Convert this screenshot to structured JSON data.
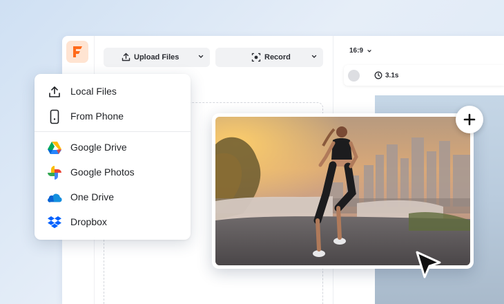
{
  "toolbar": {
    "upload_label": "Upload Files",
    "record_label": "Record"
  },
  "preview": {
    "aspect_ratio": "16:9",
    "duration": "3.1s"
  },
  "upload_menu": {
    "items": [
      {
        "label": "Local Files",
        "icon": "upload-icon"
      },
      {
        "label": "From Phone",
        "icon": "phone-icon"
      },
      {
        "label": "Google Drive",
        "icon": "google-drive-icon"
      },
      {
        "label": "Google Photos",
        "icon": "google-photos-icon"
      },
      {
        "label": "One Drive",
        "icon": "onedrive-icon"
      },
      {
        "label": "Dropbox",
        "icon": "dropbox-icon"
      }
    ]
  },
  "colors": {
    "brand": "#ff6a1a",
    "brand_bg": "#ffe4d2",
    "onedrive": "#0a64d4",
    "dropbox": "#0061fe"
  }
}
